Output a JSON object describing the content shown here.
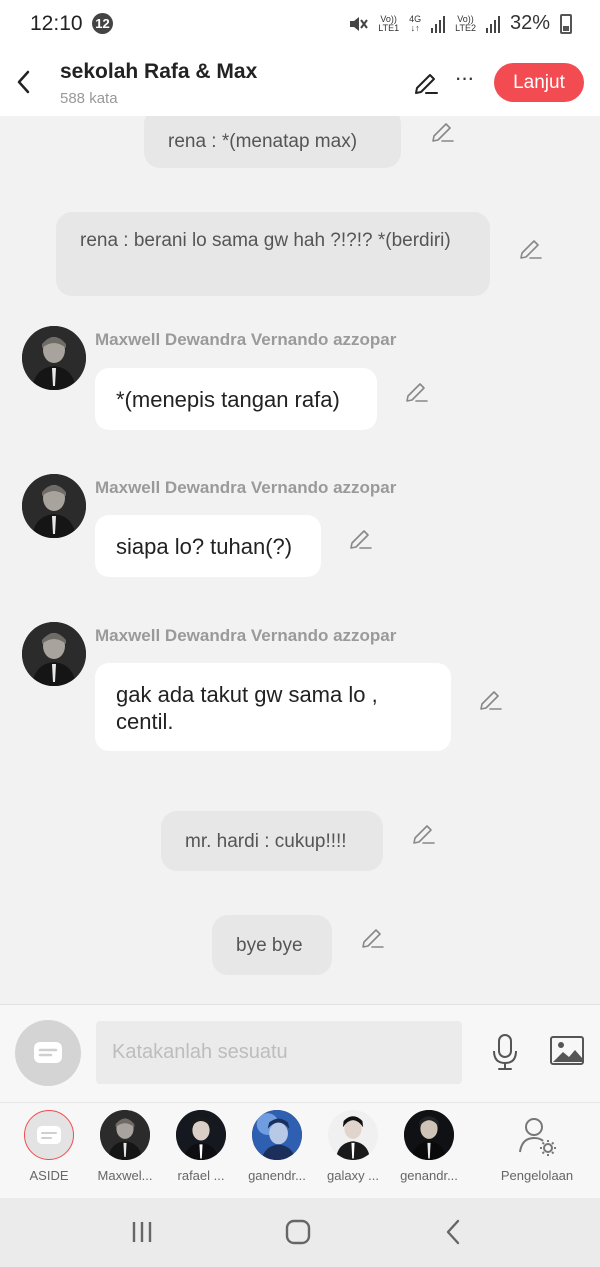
{
  "status_bar": {
    "time": "12:10",
    "notif_count": "12",
    "lte1_top": "Vo))",
    "lte1_bottom": "LTE1",
    "net_top": "4G",
    "net_bottom": "↓↑",
    "lte2_top": "Vo))",
    "lte2_bottom": "LTE2",
    "battery": "32%"
  },
  "header": {
    "title": "sekolah Rafa & Max",
    "word_count": "588 kata",
    "more": "···",
    "next_label": "Lanjut"
  },
  "messages": [
    {
      "type": "narration",
      "text": "rena : *(menatap max)"
    },
    {
      "type": "narration",
      "text": "rena : berani lo sama gw hah ?!?!? *(berdiri)"
    },
    {
      "type": "character",
      "sender": "Maxwell Dewandra Vernando azzopar",
      "text": "*(menepis tangan rafa)"
    },
    {
      "type": "character",
      "sender": "Maxwell Dewandra Vernando azzopar",
      "text": "siapa lo? tuhan(?)"
    },
    {
      "type": "character",
      "sender": "Maxwell Dewandra Vernando azzopar",
      "text": "gak ada takut gw sama lo , centil."
    },
    {
      "type": "narration",
      "text": "mr. hardi : cukup!!!!"
    },
    {
      "type": "narration",
      "text": "bye bye"
    }
  ],
  "composer": {
    "placeholder": "Katakanlah sesuatu"
  },
  "characters": [
    {
      "label": "ASIDE"
    },
    {
      "label": "Maxwel..."
    },
    {
      "label": "rafael ..."
    },
    {
      "label": "ganendr..."
    },
    {
      "label": "galaxy ..."
    },
    {
      "label": "genandr..."
    },
    {
      "label": "Pengelolaan"
    }
  ],
  "colors": {
    "accent": "#f24b51",
    "chat_bg": "#f2f2f2",
    "narration_bubble": "#e7e7e7",
    "character_bubble": "#ffffff"
  }
}
